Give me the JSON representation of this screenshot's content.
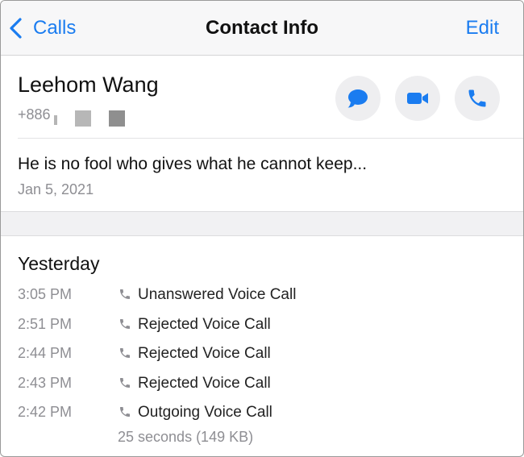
{
  "navbar": {
    "back_label": "Calls",
    "title": "Contact Info",
    "edit_label": "Edit"
  },
  "contact": {
    "name": "Leehom Wang",
    "phone_prefix": "+886",
    "status": "He is no fool who gives what he cannot keep...",
    "status_date": "Jan 5, 2021"
  },
  "actions": [
    {
      "icon": "message-bubble-icon"
    },
    {
      "icon": "video-camera-icon"
    },
    {
      "icon": "phone-icon"
    }
  ],
  "history": {
    "heading": "Yesterday",
    "calls": [
      {
        "time": "3:05 PM",
        "type": "Unanswered Voice Call"
      },
      {
        "time": "2:51 PM",
        "type": "Rejected Voice Call"
      },
      {
        "time": "2:44 PM",
        "type": "Rejected Voice Call"
      },
      {
        "time": "2:43 PM",
        "type": "Rejected Voice Call"
      },
      {
        "time": "2:42 PM",
        "type": "Outgoing Voice Call"
      }
    ],
    "last_call_detail": "25 seconds (149 KB)"
  },
  "colors": {
    "accent": "#1a7cf0",
    "secondary_text": "#8e8e93",
    "button_bg": "#eeeef0"
  }
}
